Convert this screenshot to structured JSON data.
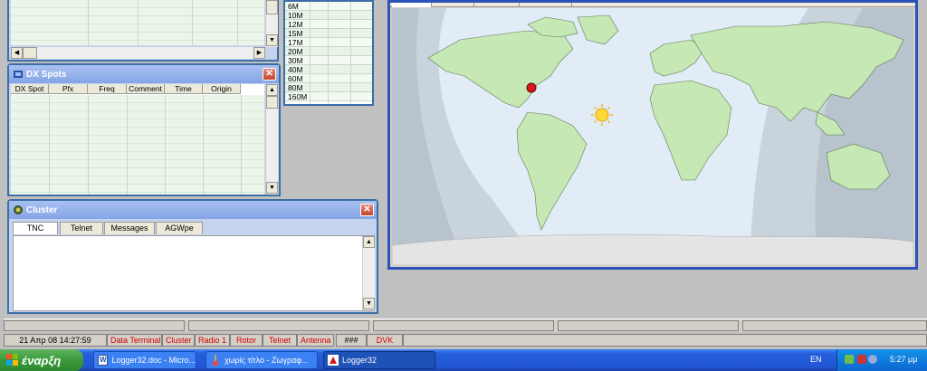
{
  "bands": [
    "6M",
    "10M",
    "12M",
    "15M",
    "17M",
    "20M",
    "30M",
    "40M",
    "60M",
    "80M",
    "160M"
  ],
  "dxspots": {
    "title": "DX Spots",
    "columns": [
      "DX Spot",
      "Pfx",
      "Freq",
      "Comment",
      "Time",
      "Origin"
    ]
  },
  "cluster": {
    "title": "Cluster",
    "tabs": [
      "TNC",
      "Telnet",
      "Messages",
      "AGWpe"
    ]
  },
  "status": {
    "datetime": "21 Απρ 08  14:27:59",
    "items": [
      "Data Terminal",
      "Cluster",
      "Radio 1",
      "Rotor",
      "Telnet",
      "Antenna",
      "###",
      "DVK"
    ]
  },
  "taskbar": {
    "start": "έναρξη",
    "tasks": [
      "Logger32.doc - Micro...",
      "χωρίς τίτλο - Ζωγραφ...",
      "Logger32"
    ],
    "lang": "EN",
    "clock": "5:27 μμ"
  }
}
